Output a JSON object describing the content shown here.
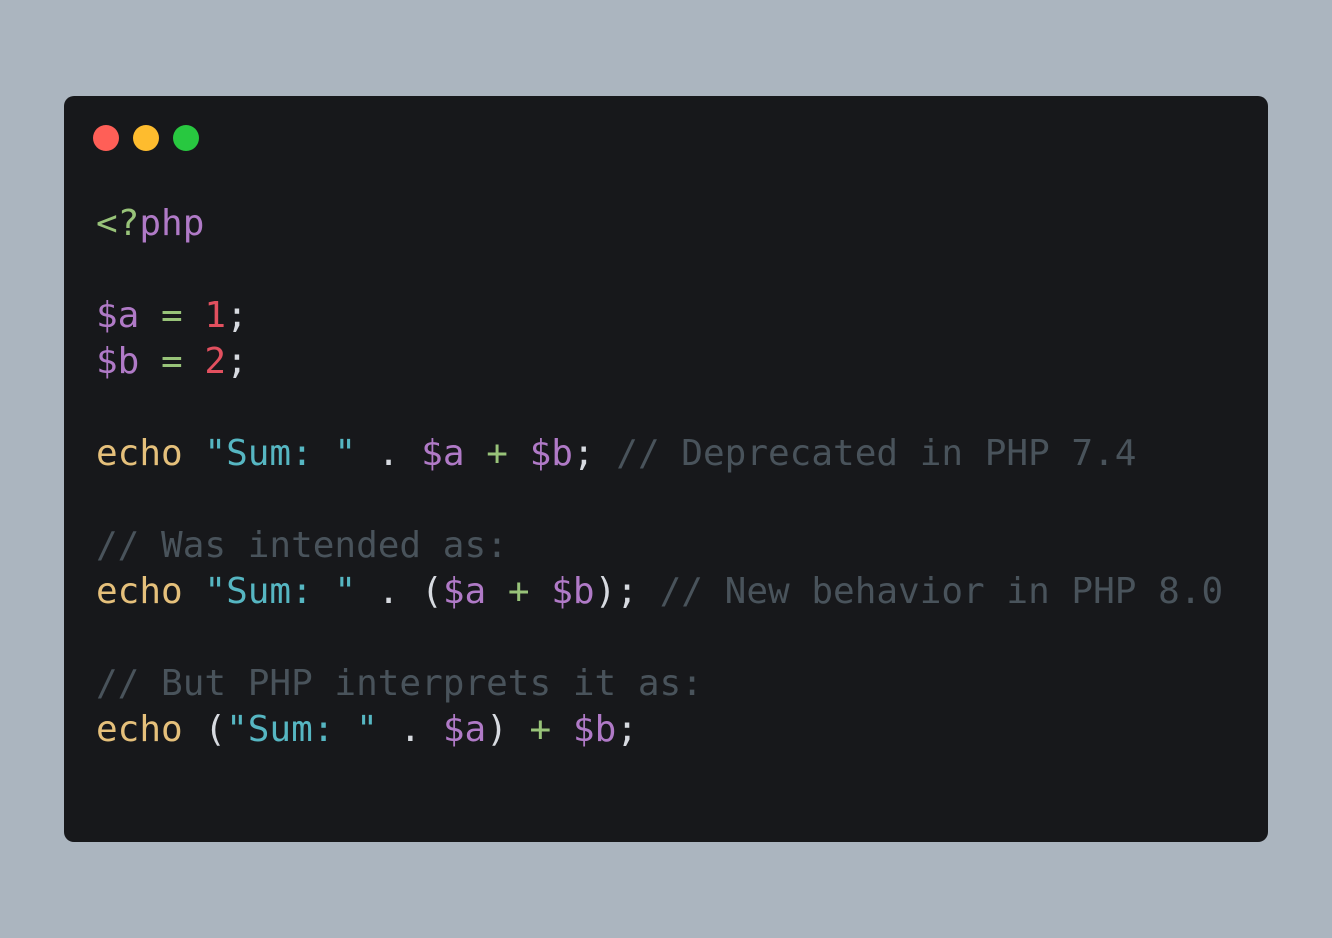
{
  "window": {
    "colors": {
      "background": "#17181b",
      "page": "#abb5bf"
    },
    "traffic_lights": [
      {
        "name": "close",
        "color": "#ff5f57"
      },
      {
        "name": "minimize",
        "color": "#febc2e"
      },
      {
        "name": "maximize",
        "color": "#28c840"
      }
    ]
  },
  "code": {
    "language": "php",
    "lines": [
      {
        "tokens": [
          {
            "t": "open",
            "v": "<?"
          },
          {
            "t": "php",
            "v": "php"
          }
        ]
      },
      {
        "tokens": []
      },
      {
        "tokens": [
          {
            "t": "var",
            "v": "$a"
          },
          {
            "t": "punc",
            "v": " "
          },
          {
            "t": "op",
            "v": "="
          },
          {
            "t": "punc",
            "v": " "
          },
          {
            "t": "num",
            "v": "1"
          },
          {
            "t": "punc",
            "v": ";"
          }
        ]
      },
      {
        "tokens": [
          {
            "t": "var",
            "v": "$b"
          },
          {
            "t": "punc",
            "v": " "
          },
          {
            "t": "op",
            "v": "="
          },
          {
            "t": "punc",
            "v": " "
          },
          {
            "t": "num",
            "v": "2"
          },
          {
            "t": "punc",
            "v": ";"
          }
        ]
      },
      {
        "tokens": []
      },
      {
        "tokens": [
          {
            "t": "kw",
            "v": "echo"
          },
          {
            "t": "punc",
            "v": " "
          },
          {
            "t": "str",
            "v": "\"Sum: \""
          },
          {
            "t": "punc",
            "v": " . "
          },
          {
            "t": "var",
            "v": "$a"
          },
          {
            "t": "punc",
            "v": " "
          },
          {
            "t": "op",
            "v": "+"
          },
          {
            "t": "punc",
            "v": " "
          },
          {
            "t": "var",
            "v": "$b"
          },
          {
            "t": "punc",
            "v": "; "
          },
          {
            "t": "com",
            "v": "// Deprecated in PHP 7.4"
          }
        ]
      },
      {
        "tokens": []
      },
      {
        "tokens": [
          {
            "t": "com",
            "v": "// Was intended as:"
          }
        ]
      },
      {
        "tokens": [
          {
            "t": "kw",
            "v": "echo"
          },
          {
            "t": "punc",
            "v": " "
          },
          {
            "t": "str",
            "v": "\"Sum: \""
          },
          {
            "t": "punc",
            "v": " . ("
          },
          {
            "t": "var",
            "v": "$a"
          },
          {
            "t": "punc",
            "v": " "
          },
          {
            "t": "op",
            "v": "+"
          },
          {
            "t": "punc",
            "v": " "
          },
          {
            "t": "var",
            "v": "$b"
          },
          {
            "t": "punc",
            "v": "); "
          },
          {
            "t": "com",
            "v": "// New behavior in PHP 8.0"
          }
        ]
      },
      {
        "tokens": []
      },
      {
        "tokens": [
          {
            "t": "com",
            "v": "// But PHP interprets it as:"
          }
        ]
      },
      {
        "tokens": [
          {
            "t": "kw",
            "v": "echo"
          },
          {
            "t": "punc",
            "v": " ("
          },
          {
            "t": "str",
            "v": "\"Sum: \""
          },
          {
            "t": "punc",
            "v": " . "
          },
          {
            "t": "var",
            "v": "$a"
          },
          {
            "t": "punc",
            "v": ") "
          },
          {
            "t": "op",
            "v": "+"
          },
          {
            "t": "punc",
            "v": " "
          },
          {
            "t": "var",
            "v": "$b"
          },
          {
            "t": "punc",
            "v": ";"
          }
        ]
      }
    ]
  }
}
